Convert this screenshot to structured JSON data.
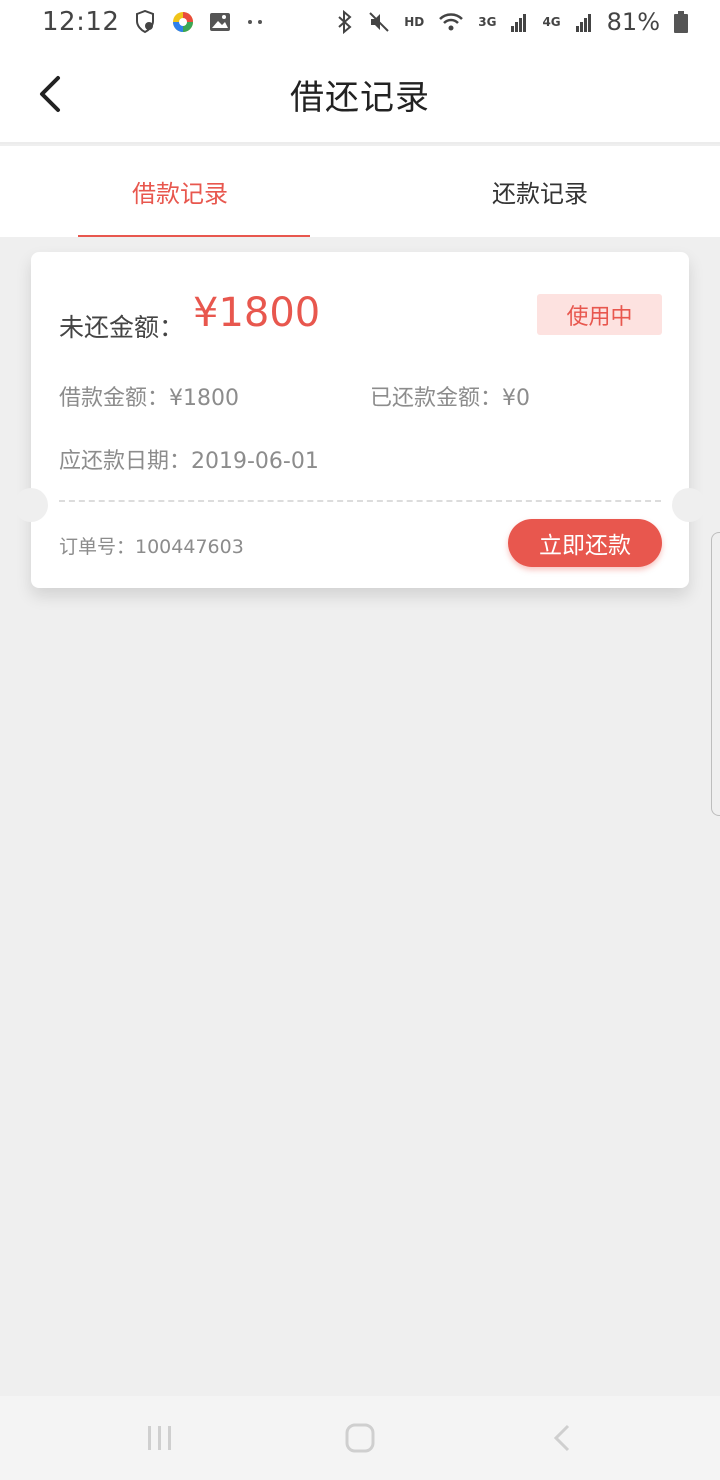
{
  "status_bar": {
    "time": "12:12",
    "hd": "HD",
    "net1": "3G",
    "net2": "4G",
    "battery": "81%"
  },
  "header": {
    "title": "借还记录",
    "back_icon": "chevron-left-icon"
  },
  "tabs": [
    {
      "label": "借款记录",
      "active": true
    },
    {
      "label": "还款记录",
      "active": false
    }
  ],
  "loan_card": {
    "outstanding_label": "未还金额：",
    "outstanding_amount": "¥1800",
    "status": "使用中",
    "loan_amount": "借款金额：¥1800",
    "repaid_amount": "已还款金额：¥0",
    "due_date": "应还款日期：2019-06-01",
    "order_no": "订单号：100447603",
    "repay_button": "立即还款"
  },
  "colors": {
    "accent": "#e8574e",
    "badge_bg": "#fde2e0",
    "page_bg": "#efefef"
  },
  "system_nav": {
    "icons": [
      "recents-icon",
      "home-icon",
      "back-icon"
    ]
  }
}
